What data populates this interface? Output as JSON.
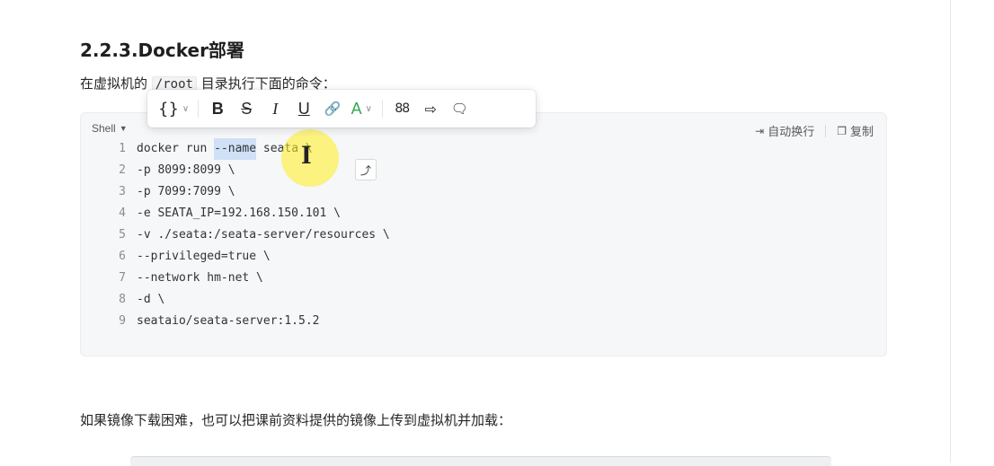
{
  "heading": "2.2.3.Docker部署",
  "intro": {
    "before": "在虚拟机的",
    "code": "/root",
    "after": "目录执行下面的命令："
  },
  "toolbar": {
    "code_icon": "{}",
    "bold": "B",
    "strike": "S",
    "italic": "I",
    "underline": "U",
    "link_icon": "🔗",
    "color": "A",
    "grid_icon": "88",
    "share_icon": "⇨",
    "comment_icon": "🗨",
    "dropdown": "∨"
  },
  "codeblock": {
    "language": "Shell",
    "wrap_label": "自动换行",
    "copy_label": "复制",
    "lines": [
      {
        "n": "1",
        "pre": "docker run ",
        "sel": "--name",
        "post": " seata \\"
      },
      {
        "n": "2",
        "pre": "-p 8099:8099 \\",
        "sel": "",
        "post": ""
      },
      {
        "n": "3",
        "pre": "-p 7099:7099 \\",
        "sel": "",
        "post": ""
      },
      {
        "n": "4",
        "pre": "-e SEATA_IP=192.168.150.101 \\",
        "sel": "",
        "post": ""
      },
      {
        "n": "5",
        "pre": "-v ./seata:/seata-server/resources \\",
        "sel": "",
        "post": ""
      },
      {
        "n": "6",
        "pre": "--privileged=true \\",
        "sel": "",
        "post": ""
      },
      {
        "n": "7",
        "pre": "--network hm-net \\",
        "sel": "",
        "post": ""
      },
      {
        "n": "8",
        "pre": "-d \\",
        "sel": "",
        "post": ""
      },
      {
        "n": "9",
        "pre": "seataio/seata-server:1.5.2",
        "sel": "",
        "post": ""
      }
    ]
  },
  "paragraph": "如果镜像下载困难，也可以把课前资料提供的镜像上传到虚拟机并加载：",
  "colors": {
    "selection": "#cfe0f7",
    "cursor_halo": "#ffee1e",
    "text_color_button": "#35a853"
  }
}
